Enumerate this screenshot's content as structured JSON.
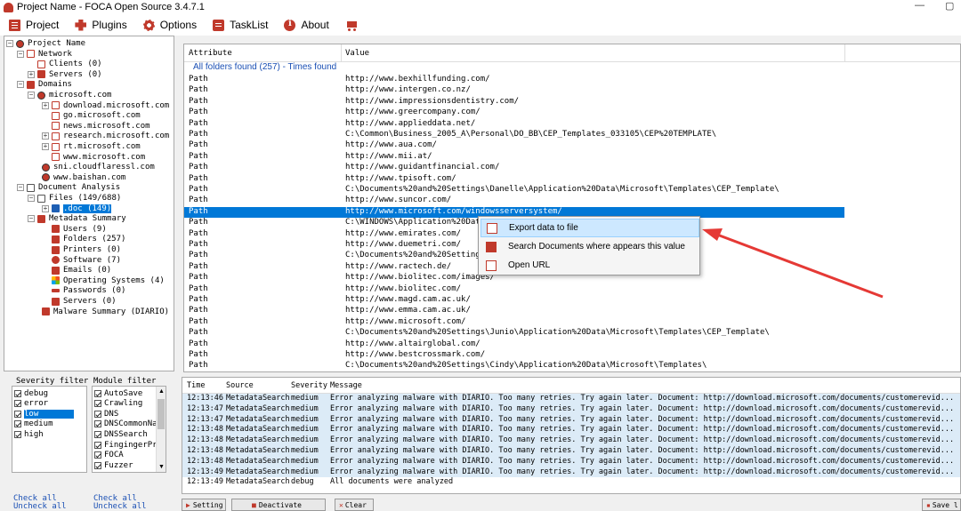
{
  "window": {
    "title": "Project Name - FOCA Open Source 3.4.7.1"
  },
  "menu": [
    {
      "label": "Project",
      "icon": "project-icon"
    },
    {
      "label": "Plugins",
      "icon": "plugin-icon"
    },
    {
      "label": "Options",
      "icon": "gear-icon"
    },
    {
      "label": "TaskList",
      "icon": "tasklist-icon"
    },
    {
      "label": "About",
      "icon": "info-icon"
    },
    {
      "label": "",
      "icon": "cart-icon"
    }
  ],
  "tree": [
    {
      "label": "Project Name",
      "icon": "globe-icon"
    },
    {
      "label": "Network",
      "icon": "network-icon"
    },
    {
      "label": "Clients (0)",
      "icon": "monitor-icon"
    },
    {
      "label": "Servers (0)",
      "icon": "server-icon"
    },
    {
      "label": "Domains",
      "icon": "domains-icon"
    },
    {
      "label": "microsoft.com",
      "icon": "globe-icon"
    },
    {
      "label": "download.microsoft.com",
      "icon": "monitor-icon"
    },
    {
      "label": "go.microsoft.com",
      "icon": "monitor-icon"
    },
    {
      "label": "news.microsoft.com",
      "icon": "monitor-icon"
    },
    {
      "label": "research.microsoft.com",
      "icon": "monitor-icon"
    },
    {
      "label": "rt.microsoft.com",
      "icon": "monitor-icon"
    },
    {
      "label": "www.microsoft.com",
      "icon": "monitor-icon"
    },
    {
      "label": "sni.cloudflaressl.com",
      "icon": "globe-icon"
    },
    {
      "label": "www.baishan.com",
      "icon": "globe-icon"
    },
    {
      "label": "Document Analysis",
      "icon": "document-icon"
    },
    {
      "label": "Files (149/688)",
      "icon": "document-icon"
    },
    {
      "label": ".doc (149)",
      "icon": "word-icon"
    },
    {
      "label": "Metadata Summary",
      "icon": "domains-icon"
    },
    {
      "label": "Users (9)",
      "icon": "users-icon"
    },
    {
      "label": "Folders (257)",
      "icon": "folder-icon"
    },
    {
      "label": "Printers (0)",
      "icon": "printer-icon"
    },
    {
      "label": "Software (7)",
      "icon": "software-icon"
    },
    {
      "label": "Emails (0)",
      "icon": "email-icon"
    },
    {
      "label": "Operating Systems (4)",
      "icon": "windows-icon"
    },
    {
      "label": "Passwords (0)",
      "icon": "key-icon"
    },
    {
      "label": "Servers (0)",
      "icon": "server-icon"
    },
    {
      "label": "Malware Summary (DIARIO)",
      "icon": "malware-icon"
    }
  ],
  "severity_filter": {
    "label": "Severity filter",
    "items": [
      {
        "label": "debug",
        "checked": true
      },
      {
        "label": "error",
        "checked": true
      },
      {
        "label": "low",
        "checked": true
      },
      {
        "label": "medium",
        "checked": true
      },
      {
        "label": "high",
        "checked": true
      }
    ],
    "check_all": "Check all",
    "uncheck_all": "Uncheck all"
  },
  "module_filter": {
    "label": "Module filter",
    "items": [
      {
        "label": "AutoSave",
        "checked": true
      },
      {
        "label": "Crawling",
        "checked": true
      },
      {
        "label": "DNS",
        "checked": true
      },
      {
        "label": "DNSCommonName",
        "checked": true
      },
      {
        "label": "DNSSearch",
        "checked": true
      },
      {
        "label": "FingingerPrin",
        "checked": true
      },
      {
        "label": "FOCA",
        "checked": true
      },
      {
        "label": "Fuzzer",
        "checked": true
      }
    ],
    "check_all": "Check all",
    "uncheck_all": "Uncheck all"
  },
  "grid": {
    "col_attribute": "Attribute",
    "col_value": "Value",
    "group_header": "All folders found (257) - Times found",
    "rows": [
      [
        "Path",
        "http://www.bexhillfunding.com/"
      ],
      [
        "Path",
        "http://www.intergen.co.nz/"
      ],
      [
        "Path",
        "http://www.impressionsdentistry.com/"
      ],
      [
        "Path",
        "http://www.greercompany.com/"
      ],
      [
        "Path",
        "http://www.applieddata.net/"
      ],
      [
        "Path",
        "C:\\Common\\Business_2005_A\\Personal\\DO_BB\\CEP_Templates_033105\\CEP%20TEMPLATE\\"
      ],
      [
        "Path",
        "http://www.aua.com/"
      ],
      [
        "Path",
        "http://www.mii.at/"
      ],
      [
        "Path",
        "http://www.guidantfinancial.com/"
      ],
      [
        "Path",
        "http://www.tpisoft.com/"
      ],
      [
        "Path",
        "C:\\Documents%20and%20Settings\\Danelle\\Application%20Data\\Microsoft\\Templates\\CEP_Template\\"
      ],
      [
        "Path",
        "http://www.suncor.com/"
      ],
      [
        "Path",
        "http://www.microsoft.com/windowsserversystem/"
      ],
      [
        "Path",
        "C:\\WINDOWS\\Application%20Data\\Micr"
      ],
      [
        "Path",
        "http://www.emirates.com/"
      ],
      [
        "Path",
        "http://www.duemetri.com/"
      ],
      [
        "Path",
        "C:\\Documents%20and%20Settings\\v-ju"
      ],
      [
        "Path",
        "http://www.ractech.de/"
      ],
      [
        "Path",
        "http://www.biolitec.com/images/"
      ],
      [
        "Path",
        "http://www.biolitec.com/"
      ],
      [
        "Path",
        "http://www.magd.cam.ac.uk/"
      ],
      [
        "Path",
        "http://www.emma.cam.ac.uk/"
      ],
      [
        "Path",
        "http://www.microsoft.com/"
      ],
      [
        "Path",
        "C:\\Documents%20and%20Settings\\Junio\\Application%20Data\\Microsoft\\Templates\\CEP_Template\\"
      ],
      [
        "Path",
        "http://www.altairglobal.com/"
      ],
      [
        "Path",
        "http://www.bestcrossmark.com/"
      ],
      [
        "Path",
        "C:\\Documents%20and%20Settings\\Cindy\\Application%20Data\\Microsoft\\Templates\\"
      ]
    ]
  },
  "context_menu": [
    {
      "label": "Export  data to file",
      "icon": "export-icon"
    },
    {
      "label": "Search Documents where appears this value",
      "icon": "search-icon"
    },
    {
      "label": "Open URL",
      "icon": "open-url-icon"
    }
  ],
  "log": {
    "columns": [
      "Time",
      "Source",
      "Severity",
      "Message"
    ],
    "rows": [
      [
        "12:13:46",
        "MetadataSearch",
        "medium",
        "Error analyzing malware with DIARIO. Too many retries. Try again later. Document: http://download.microsoft.com/documents/customerevid..."
      ],
      [
        "12:13:47",
        "MetadataSearch",
        "medium",
        "Error analyzing malware with DIARIO. Too many retries. Try again later. Document: http://download.microsoft.com/documents/customerevid..."
      ],
      [
        "12:13:47",
        "MetadataSearch",
        "medium",
        "Error analyzing malware with DIARIO. Too many retries. Try again later. Document: http://download.microsoft.com/documents/customerevid..."
      ],
      [
        "12:13:48",
        "MetadataSearch",
        "medium",
        "Error analyzing malware with DIARIO. Too many retries. Try again later. Document: http://download.microsoft.com/documents/customerevid..."
      ],
      [
        "12:13:48",
        "MetadataSearch",
        "medium",
        "Error analyzing malware with DIARIO. Too many retries. Try again later. Document: http://download.microsoft.com/documents/customerevid..."
      ],
      [
        "12:13:48",
        "MetadataSearch",
        "medium",
        "Error analyzing malware with DIARIO. Too many retries. Try again later. Document: http://download.microsoft.com/documents/customerevid..."
      ],
      [
        "12:13:48",
        "MetadataSearch",
        "medium",
        "Error analyzing malware with DIARIO. Too many retries. Try again later. Document: http://download.microsoft.com/documents/customerevid..."
      ],
      [
        "12:13:49",
        "MetadataSearch",
        "medium",
        "Error analyzing malware with DIARIO. Too many retries. Try again later. Document: http://download.microsoft.com/documents/customerevid..."
      ],
      [
        "12:13:49",
        "MetadataSearch",
        "debug",
        "All documents were analyzed"
      ]
    ]
  },
  "bottom_buttons": {
    "setting": "Setting",
    "deactivate": "Deactivate",
    "clear": "Clear",
    "save": "Save l"
  },
  "colors": {
    "accent": "#c0392b",
    "selection": "#0078d7",
    "arrow": "#e53935",
    "log_row": "#dcebf7",
    "group_header": "#1a4fb4"
  }
}
